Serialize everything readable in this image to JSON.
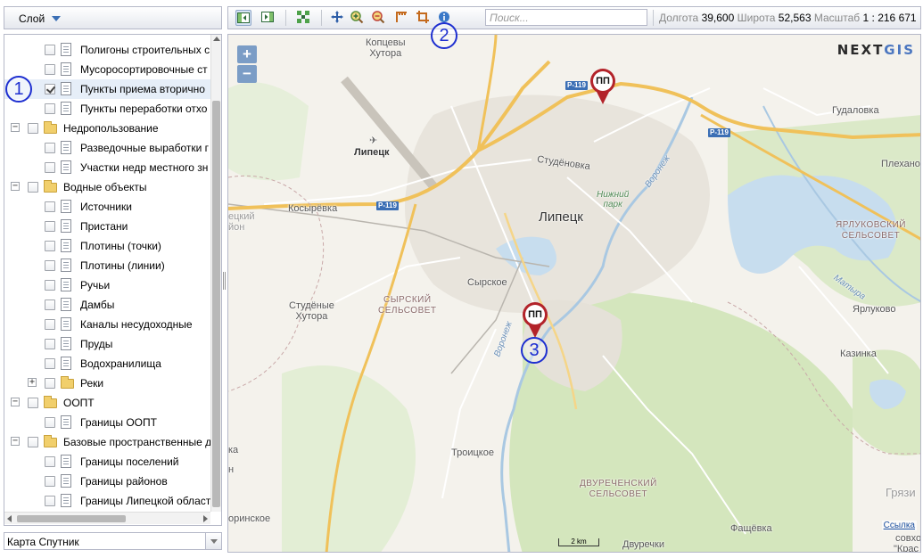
{
  "layer_panel": {
    "header_label": "Слой",
    "rows": [
      {
        "label": "Полигоны строительных с",
        "checked": false
      },
      {
        "label": "Мусоросортировочные ст",
        "checked": false
      },
      {
        "label": "Пункты приема вторично",
        "checked": true
      },
      {
        "label": "Пункты переработки отхо",
        "checked": false
      },
      {
        "label": "Недропользование",
        "group": true,
        "expander": "−"
      },
      {
        "label": "Разведочные выработки г",
        "checked": false
      },
      {
        "label": "Участки недр местного зн",
        "checked": false
      },
      {
        "label": "Водные объекты",
        "group": true,
        "expander": "−"
      },
      {
        "label": "Источники",
        "checked": false
      },
      {
        "label": "Пристани",
        "checked": false
      },
      {
        "label": "Плотины (точки)",
        "checked": false
      },
      {
        "label": "Плотины (линии)",
        "checked": false
      },
      {
        "label": "Ручьи",
        "checked": false
      },
      {
        "label": "Дамбы",
        "checked": false
      },
      {
        "label": "Каналы несудоходные",
        "checked": false
      },
      {
        "label": "Пруды",
        "checked": false
      },
      {
        "label": "Водохранилища",
        "checked": false
      },
      {
        "label": "Реки",
        "group": true,
        "expander": "+"
      },
      {
        "label": "ООПТ",
        "group": true,
        "expander": "−"
      },
      {
        "label": "Границы ООПТ",
        "checked": false
      },
      {
        "label": "Базовые пространственные д",
        "group": true,
        "expander": "−"
      },
      {
        "label": "Границы поселений",
        "checked": false
      },
      {
        "label": "Границы районов",
        "checked": false
      },
      {
        "label": "Границы Липецкой област",
        "checked": false
      }
    ],
    "basemap_value": "Карта Спутник"
  },
  "toolbar": {
    "search_placeholder": "Поиск...",
    "lon_label": "Долгота",
    "lon_value": "39,600",
    "lat_label": "Широта",
    "lat_value": "52,563",
    "scale_label": "Масштаб",
    "scale_value": "1 : 216 671",
    "icons": [
      "zoom-prev-icon",
      "zoom-next-icon",
      "zoom-extent-icon",
      "pan-icon",
      "zoom-in-tool-icon",
      "zoom-out-tool-icon",
      "measure-icon",
      "crop-icon",
      "identify-icon"
    ]
  },
  "map": {
    "zoom_in": "+",
    "zoom_out": "−",
    "logo_prefix": "N",
    "logo_mid": "E",
    "logo_rest": "XT",
    "logo_accent": "GIS",
    "marker_label": "ПП",
    "scale_text": "2 km",
    "attribution": "Ссылка",
    "labels": {
      "koptsevy": "Копцевы\nХутора",
      "lipetsk_airport": "Липецк",
      "gudalovka": "Гудаловка",
      "plekhanovo": "Плехано",
      "studenovka": "Студёновка",
      "voronezh_river": "Воронеж",
      "nizhniy_park": "Нижний\nпарк",
      "lipetsk": "Липецк",
      "kosyrevka": "Косырёвка",
      "lipetsk_rayon_left": "ецкий\nйон",
      "yarlukovsky": "ЯРЛУКОВСКИЙ\nСЕЛЬСОВЕТ",
      "syrskoe": "Сырское",
      "syrsky_sov": "СЫРСКИЙ\nСЕЛЬСОВЕТ",
      "matyra": "Матыра",
      "studenye_khutora": "Студёные\nХутора",
      "voronezh_south": "Воронеж",
      "yarlukovo": "Ярлуково",
      "kazinka": "Казинка",
      "troitskoe": "Троицкое",
      "dvurechensky": "ДВУРЕЧЕНСКИЙ\nСЕЛЬСОВЕТ",
      "gryazi": "Грязи",
      "orinskoe": "оринское",
      "fashchevka": "Фащёвка",
      "dvurechki": "Двуречки",
      "sovkho": "совхо",
      "krasn": "\"Крас",
      "left_ka": "ка",
      "left_n": "н"
    },
    "road_shield": "Р-119"
  },
  "callouts": [
    "1",
    "2",
    "3"
  ],
  "colors": {
    "marker": "#b3232a",
    "callout": "#1e2fd0",
    "road_major": "#f5c45e",
    "water": "#c7ddee",
    "forest": "#cfe2b6",
    "shield": "#3b6fb5"
  }
}
